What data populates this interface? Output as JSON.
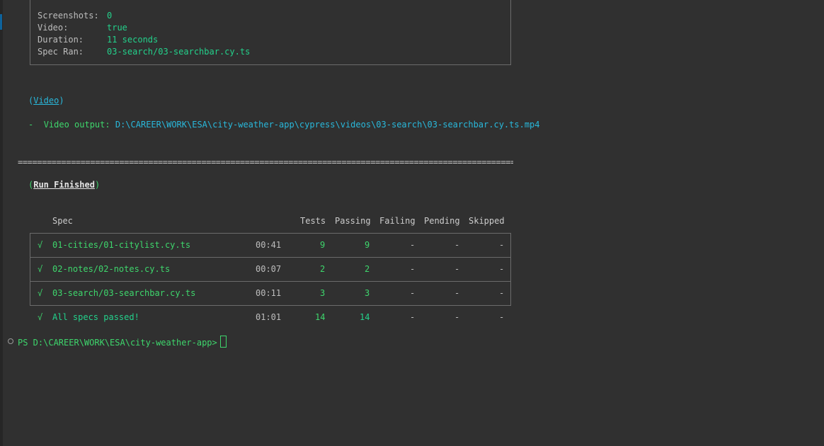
{
  "run_info": {
    "rows": [
      {
        "label": "Screenshots:",
        "value": "0"
      },
      {
        "label": "Video:",
        "value": "true"
      },
      {
        "label": "Duration:",
        "value": "11 seconds"
      },
      {
        "label": "Spec Ran:",
        "value": "03-search/03-searchbar.cy.ts"
      }
    ]
  },
  "video_section": {
    "open_paren": "(",
    "title": "Video",
    "close_paren": ")",
    "dash": "-",
    "output_label": "Video output:",
    "output_path": "D:\\CAREER\\WORK\\ESA\\city-weather-app\\cypress\\videos\\03-search\\03-searchbar.cy.ts.mp4"
  },
  "separator": "======================================================================================================================",
  "run_finished": {
    "open_paren": "(",
    "title": "Run Finished",
    "close_paren": ")"
  },
  "table": {
    "headers": {
      "spec": "Spec",
      "tests": "Tests",
      "passing": "Passing",
      "failing": "Failing",
      "pending": "Pending",
      "skipped": "Skipped"
    },
    "rows": [
      {
        "check": "√",
        "spec": "01-cities/01-citylist.cy.ts",
        "time": "00:41",
        "tests": "9",
        "passing": "9",
        "failing": "-",
        "pending": "-",
        "skipped": "-"
      },
      {
        "check": "√",
        "spec": "02-notes/02-notes.cy.ts",
        "time": "00:07",
        "tests": "2",
        "passing": "2",
        "failing": "-",
        "pending": "-",
        "skipped": "-"
      },
      {
        "check": "√",
        "spec": "03-search/03-searchbar.cy.ts",
        "time": "00:11",
        "tests": "3",
        "passing": "3",
        "failing": "-",
        "pending": "-",
        "skipped": "-"
      }
    ],
    "summary": {
      "check": "√",
      "label": "All specs passed!",
      "time": "01:01",
      "tests": "14",
      "passing": "14",
      "failing": "-",
      "pending": "-",
      "skipped": "-"
    }
  },
  "prompt": {
    "text": "PS D:\\CAREER\\WORK\\ESA\\city-weather-app>"
  },
  "colors": {
    "background": "#303030",
    "green": "#23d18b",
    "cyan": "#29b8db",
    "border": "#6b6b6b"
  }
}
